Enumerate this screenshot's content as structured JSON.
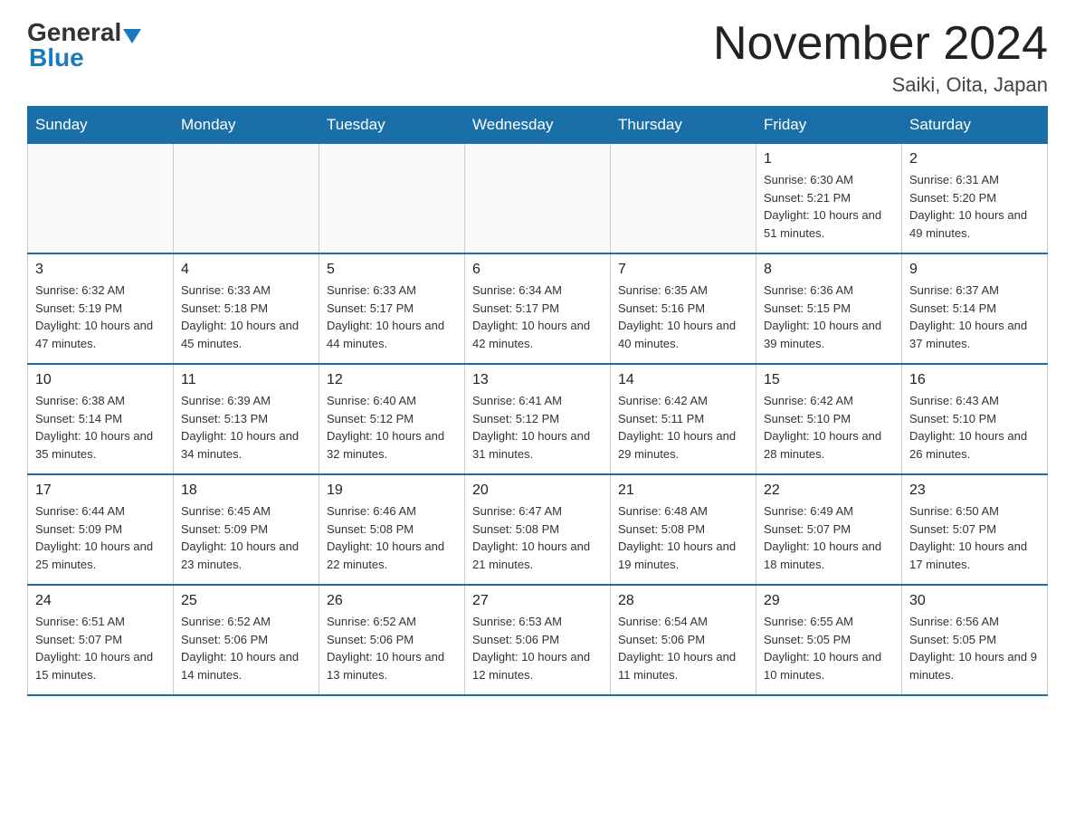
{
  "logo": {
    "general": "General",
    "blue": "Blue"
  },
  "title": "November 2024",
  "location": "Saiki, Oita, Japan",
  "days_of_week": [
    "Sunday",
    "Monday",
    "Tuesday",
    "Wednesday",
    "Thursday",
    "Friday",
    "Saturday"
  ],
  "weeks": [
    [
      {
        "day": "",
        "sunrise": "",
        "sunset": "",
        "daylight": "",
        "empty": true
      },
      {
        "day": "",
        "sunrise": "",
        "sunset": "",
        "daylight": "",
        "empty": true
      },
      {
        "day": "",
        "sunrise": "",
        "sunset": "",
        "daylight": "",
        "empty": true
      },
      {
        "day": "",
        "sunrise": "",
        "sunset": "",
        "daylight": "",
        "empty": true
      },
      {
        "day": "",
        "sunrise": "",
        "sunset": "",
        "daylight": "",
        "empty": true
      },
      {
        "day": "1",
        "sunrise": "Sunrise: 6:30 AM",
        "sunset": "Sunset: 5:21 PM",
        "daylight": "Daylight: 10 hours and 51 minutes.",
        "empty": false
      },
      {
        "day": "2",
        "sunrise": "Sunrise: 6:31 AM",
        "sunset": "Sunset: 5:20 PM",
        "daylight": "Daylight: 10 hours and 49 minutes.",
        "empty": false
      }
    ],
    [
      {
        "day": "3",
        "sunrise": "Sunrise: 6:32 AM",
        "sunset": "Sunset: 5:19 PM",
        "daylight": "Daylight: 10 hours and 47 minutes.",
        "empty": false
      },
      {
        "day": "4",
        "sunrise": "Sunrise: 6:33 AM",
        "sunset": "Sunset: 5:18 PM",
        "daylight": "Daylight: 10 hours and 45 minutes.",
        "empty": false
      },
      {
        "day": "5",
        "sunrise": "Sunrise: 6:33 AM",
        "sunset": "Sunset: 5:17 PM",
        "daylight": "Daylight: 10 hours and 44 minutes.",
        "empty": false
      },
      {
        "day": "6",
        "sunrise": "Sunrise: 6:34 AM",
        "sunset": "Sunset: 5:17 PM",
        "daylight": "Daylight: 10 hours and 42 minutes.",
        "empty": false
      },
      {
        "day": "7",
        "sunrise": "Sunrise: 6:35 AM",
        "sunset": "Sunset: 5:16 PM",
        "daylight": "Daylight: 10 hours and 40 minutes.",
        "empty": false
      },
      {
        "day": "8",
        "sunrise": "Sunrise: 6:36 AM",
        "sunset": "Sunset: 5:15 PM",
        "daylight": "Daylight: 10 hours and 39 minutes.",
        "empty": false
      },
      {
        "day": "9",
        "sunrise": "Sunrise: 6:37 AM",
        "sunset": "Sunset: 5:14 PM",
        "daylight": "Daylight: 10 hours and 37 minutes.",
        "empty": false
      }
    ],
    [
      {
        "day": "10",
        "sunrise": "Sunrise: 6:38 AM",
        "sunset": "Sunset: 5:14 PM",
        "daylight": "Daylight: 10 hours and 35 minutes.",
        "empty": false
      },
      {
        "day": "11",
        "sunrise": "Sunrise: 6:39 AM",
        "sunset": "Sunset: 5:13 PM",
        "daylight": "Daylight: 10 hours and 34 minutes.",
        "empty": false
      },
      {
        "day": "12",
        "sunrise": "Sunrise: 6:40 AM",
        "sunset": "Sunset: 5:12 PM",
        "daylight": "Daylight: 10 hours and 32 minutes.",
        "empty": false
      },
      {
        "day": "13",
        "sunrise": "Sunrise: 6:41 AM",
        "sunset": "Sunset: 5:12 PM",
        "daylight": "Daylight: 10 hours and 31 minutes.",
        "empty": false
      },
      {
        "day": "14",
        "sunrise": "Sunrise: 6:42 AM",
        "sunset": "Sunset: 5:11 PM",
        "daylight": "Daylight: 10 hours and 29 minutes.",
        "empty": false
      },
      {
        "day": "15",
        "sunrise": "Sunrise: 6:42 AM",
        "sunset": "Sunset: 5:10 PM",
        "daylight": "Daylight: 10 hours and 28 minutes.",
        "empty": false
      },
      {
        "day": "16",
        "sunrise": "Sunrise: 6:43 AM",
        "sunset": "Sunset: 5:10 PM",
        "daylight": "Daylight: 10 hours and 26 minutes.",
        "empty": false
      }
    ],
    [
      {
        "day": "17",
        "sunrise": "Sunrise: 6:44 AM",
        "sunset": "Sunset: 5:09 PM",
        "daylight": "Daylight: 10 hours and 25 minutes.",
        "empty": false
      },
      {
        "day": "18",
        "sunrise": "Sunrise: 6:45 AM",
        "sunset": "Sunset: 5:09 PM",
        "daylight": "Daylight: 10 hours and 23 minutes.",
        "empty": false
      },
      {
        "day": "19",
        "sunrise": "Sunrise: 6:46 AM",
        "sunset": "Sunset: 5:08 PM",
        "daylight": "Daylight: 10 hours and 22 minutes.",
        "empty": false
      },
      {
        "day": "20",
        "sunrise": "Sunrise: 6:47 AM",
        "sunset": "Sunset: 5:08 PM",
        "daylight": "Daylight: 10 hours and 21 minutes.",
        "empty": false
      },
      {
        "day": "21",
        "sunrise": "Sunrise: 6:48 AM",
        "sunset": "Sunset: 5:08 PM",
        "daylight": "Daylight: 10 hours and 19 minutes.",
        "empty": false
      },
      {
        "day": "22",
        "sunrise": "Sunrise: 6:49 AM",
        "sunset": "Sunset: 5:07 PM",
        "daylight": "Daylight: 10 hours and 18 minutes.",
        "empty": false
      },
      {
        "day": "23",
        "sunrise": "Sunrise: 6:50 AM",
        "sunset": "Sunset: 5:07 PM",
        "daylight": "Daylight: 10 hours and 17 minutes.",
        "empty": false
      }
    ],
    [
      {
        "day": "24",
        "sunrise": "Sunrise: 6:51 AM",
        "sunset": "Sunset: 5:07 PM",
        "daylight": "Daylight: 10 hours and 15 minutes.",
        "empty": false
      },
      {
        "day": "25",
        "sunrise": "Sunrise: 6:52 AM",
        "sunset": "Sunset: 5:06 PM",
        "daylight": "Daylight: 10 hours and 14 minutes.",
        "empty": false
      },
      {
        "day": "26",
        "sunrise": "Sunrise: 6:52 AM",
        "sunset": "Sunset: 5:06 PM",
        "daylight": "Daylight: 10 hours and 13 minutes.",
        "empty": false
      },
      {
        "day": "27",
        "sunrise": "Sunrise: 6:53 AM",
        "sunset": "Sunset: 5:06 PM",
        "daylight": "Daylight: 10 hours and 12 minutes.",
        "empty": false
      },
      {
        "day": "28",
        "sunrise": "Sunrise: 6:54 AM",
        "sunset": "Sunset: 5:06 PM",
        "daylight": "Daylight: 10 hours and 11 minutes.",
        "empty": false
      },
      {
        "day": "29",
        "sunrise": "Sunrise: 6:55 AM",
        "sunset": "Sunset: 5:05 PM",
        "daylight": "Daylight: 10 hours and 10 minutes.",
        "empty": false
      },
      {
        "day": "30",
        "sunrise": "Sunrise: 6:56 AM",
        "sunset": "Sunset: 5:05 PM",
        "daylight": "Daylight: 10 hours and 9 minutes.",
        "empty": false
      }
    ]
  ]
}
